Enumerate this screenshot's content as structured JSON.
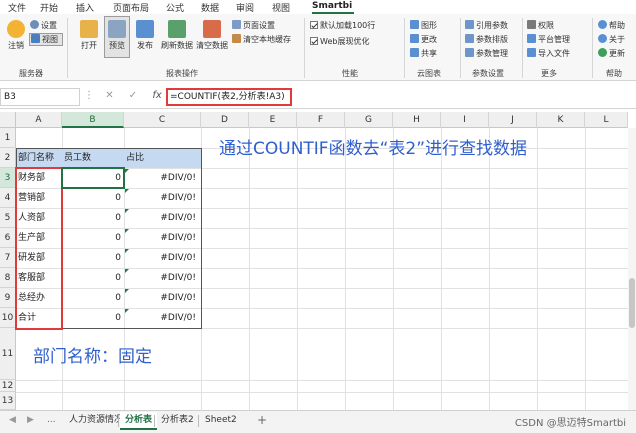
{
  "menu": {
    "items": [
      "文件",
      "开始",
      "插入",
      "页面布局",
      "公式",
      "数据",
      "审阅",
      "视图",
      "Smartbi"
    ],
    "active": "Smartbi"
  },
  "ribbon": {
    "server": {
      "logout": "注销",
      "settings": "设置",
      "view": "视图",
      "group_label": "服务器"
    },
    "report_ops": {
      "open": "打开",
      "preview": "预览",
      "publish": "发布",
      "refresh_data": "刷新数据",
      "clear_data": "清空数据",
      "page_setup": "页面设置",
      "clear_cache": "清空本地缓存",
      "group_label": "报表操作"
    },
    "performance": {
      "default_load_100": "默认加载100行",
      "web_optimize": "Web展现优化",
      "group_label": "性能"
    },
    "cloud_table": {
      "chart": "图形",
      "change": "更改",
      "share": "共享",
      "group_label": "云图表"
    },
    "params": {
      "ref_param": "引用参数",
      "param_layout": "参数排版",
      "param_manage": "参数管理",
      "group_label": "参数设置"
    },
    "more": {
      "permission": "权限",
      "platform_manage": "平台管理",
      "import_file": "导入文件",
      "group_label": "更多"
    },
    "help": {
      "help": "帮助",
      "about": "关于",
      "update": "更新",
      "group_label": "帮助"
    }
  },
  "formula_bar": {
    "cell_ref": "B3",
    "formula": "=COUNTIF(表2,分析表!A3)"
  },
  "sheet": {
    "columns": [
      "A",
      "B",
      "C",
      "D",
      "E",
      "F",
      "G",
      "H",
      "I",
      "J",
      "K",
      "L"
    ],
    "selected_column": "B",
    "rows": [
      "1",
      "2",
      "3",
      "4",
      "5",
      "6",
      "7",
      "8",
      "9",
      "10",
      "11",
      "12",
      "13"
    ],
    "selected_row": "3",
    "table_header": [
      "部门名称",
      "员工数",
      "占比"
    ],
    "table_rows": [
      [
        "财务部",
        "0",
        "#DIV/0!"
      ],
      [
        "营销部",
        "0",
        "#DIV/0!"
      ],
      [
        "人资部",
        "0",
        "#DIV/0!"
      ],
      [
        "生产部",
        "0",
        "#DIV/0!"
      ],
      [
        "研发部",
        "0",
        "#DIV/0!"
      ],
      [
        "客服部",
        "0",
        "#DIV/0!"
      ],
      [
        "总经办",
        "0",
        "#DIV/0!"
      ],
      [
        "合计",
        "0",
        "#DIV/0!"
      ]
    ],
    "note_top": "通过COUNTIF函数去“表2”进行查找数据",
    "note_bottom": "部门名称：固定"
  },
  "tabs": {
    "items": [
      "人力资源情况",
      "分析表",
      "分析表2",
      "Sheet2"
    ],
    "active": "分析表",
    "add_symbol": "+",
    "ellipsis": "..."
  },
  "watermark": "CSDN @思迈特Smartbi",
  "colors": {
    "excel_green": "#217346",
    "header_fill": "#c5d9f1",
    "highlight_red": "#e03a3a",
    "note_blue": "#2f5fce"
  }
}
